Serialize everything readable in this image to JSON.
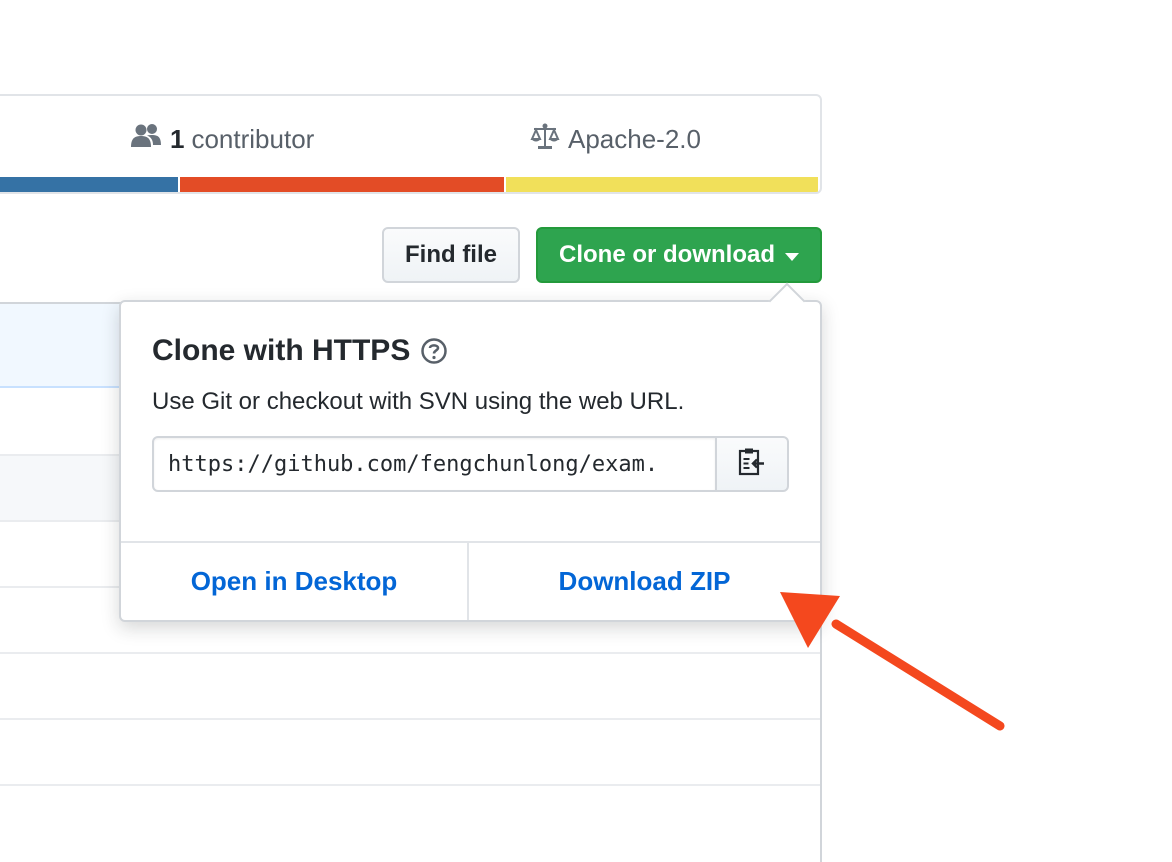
{
  "repo_stats": {
    "contributors_count": "1",
    "contributors_label": "contributor",
    "license": "Apache-2.0",
    "contributors_icon": "people-icon",
    "license_icon": "law-icon"
  },
  "language_colors": [
    "#3572A5",
    "#e34c26",
    "#f1e05a"
  ],
  "toolbar": {
    "find_file_label": "Find file",
    "clone_label": "Clone or download",
    "clone_color": "#2ea44f"
  },
  "clone_dropdown": {
    "title": "Clone with HTTPS",
    "description": "Use Git or checkout with SVN using the web URL.",
    "url": "https://github.com/fengchunlong/exam.",
    "open_desktop_label": "Open in Desktop",
    "download_zip_label": "Download ZIP",
    "link_color": "#0366d6"
  },
  "annotation_color": "#f4481e"
}
